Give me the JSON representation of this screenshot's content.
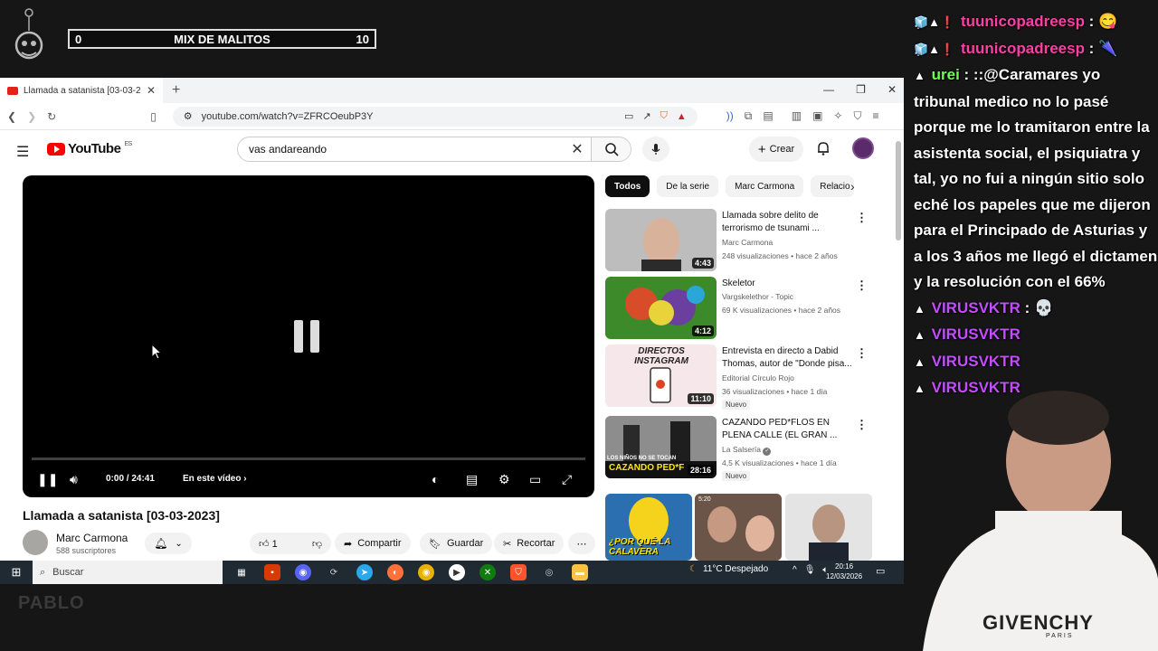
{
  "overlay": {
    "mix_left": "0",
    "mix_title": "MIX DE MALITOS",
    "mix_right": "10"
  },
  "browser": {
    "tab_title": "Llamada a satanista [03-03-2023",
    "url": "youtube.com/watch?v=ZFRCOeubP3Y"
  },
  "youtube": {
    "logo_text": "YouTube",
    "logo_region": "ES",
    "search_query": "vas andareando",
    "create_label": "Crear",
    "player": {
      "time": "0:00 / 24:41",
      "chapter_label": "En este vídeo",
      "progress": 0.0
    },
    "video_title": "Llamada a satanista [03-03-2023]",
    "channel_name": "Marc Carmona",
    "channel_subs": "588 suscriptores",
    "like_count": "1",
    "share_label": "Compartir",
    "save_label": "Guardar",
    "clip_label": "Recortar",
    "chips": [
      "Todos",
      "De la serie",
      "Marc Carmona",
      "Relacio"
    ],
    "recommendations": [
      {
        "title": "Llamada sobre delito de terrorismo de tsunami ...",
        "channel": "Marc Carmona",
        "meta": "248 visualizaciones • hace 2 años",
        "duration": "4:43",
        "badge": ""
      },
      {
        "title": "Skeletor",
        "channel": "Vargskelethor - Topic",
        "meta": "69 K visualizaciones • hace 2 años",
        "duration": "4:12",
        "badge": ""
      },
      {
        "title": "Entrevista en directo a Dabid Thomas, autor de \"Donde pisa...",
        "channel": "Editorial Círculo Rojo",
        "meta": "36 visualizaciones • hace 1 día",
        "duration": "11:10",
        "badge": "Nuevo"
      },
      {
        "title": "CAZANDO PED*FLOS EN PLENA CALLE (EL GRAN ...",
        "channel": "La Salsería",
        "meta": "4,5 K visualizaciones • hace 1 día",
        "duration": "28:16",
        "badge": "Nuevo"
      }
    ],
    "thumb_texts": {
      "instagram": "DIRECTOS INSTAGRAM",
      "cazando": "CAZANDO PED*F",
      "ninos": "LOS NIÑOS NO SE TOCAN",
      "short1": "¿POR QUÉ LA CALAVERA",
      "short2_badge": "5:20"
    }
  },
  "taskbar": {
    "search_placeholder": "Buscar",
    "weather": "11°C  Despejado",
    "time": "20:16",
    "date": "12/03/2026"
  },
  "chat": [
    {
      "user": "tuunicopadreesp",
      "sep": " :",
      "msg": "",
      "color": "pink",
      "emote": "yes"
    },
    {
      "user": "tuunicopadreesp",
      "sep": " :",
      "msg": "",
      "color": "pink",
      "emote": "yes"
    },
    {
      "user": "urei",
      "sep": " : ",
      "msg": "::@Caramares yo tribunal medico no lo pasé porque me lo tramitaron entre la asistenta social, el psiquiatra y tal, yo no fui a ningún sitio solo eché los papeles que me dijeron para el Principado de Asturias y a los 3 años me llegó el dictamen y la resolución con el 66%",
      "color": "green",
      "emote": ""
    },
    {
      "user": "VIRUSVKTR",
      "sep": " :",
      "msg": "",
      "color": "violet",
      "emote": "yes"
    },
    {
      "user": "VIRUSVKTR",
      "sep": "",
      "msg": "",
      "color": "violet",
      "emote": ""
    },
    {
      "user": "VIRUSVKTR",
      "sep": "",
      "msg": "",
      "color": "violet",
      "emote": ""
    },
    {
      "user": "VIRUSVKTR",
      "sep": "",
      "msg": "",
      "color": "violet",
      "emote": ""
    }
  ],
  "webcam": {
    "hoodie_text": "GIVENCHY",
    "hoodie_sub": "PARIS"
  },
  "stream_brand": "PABLO"
}
